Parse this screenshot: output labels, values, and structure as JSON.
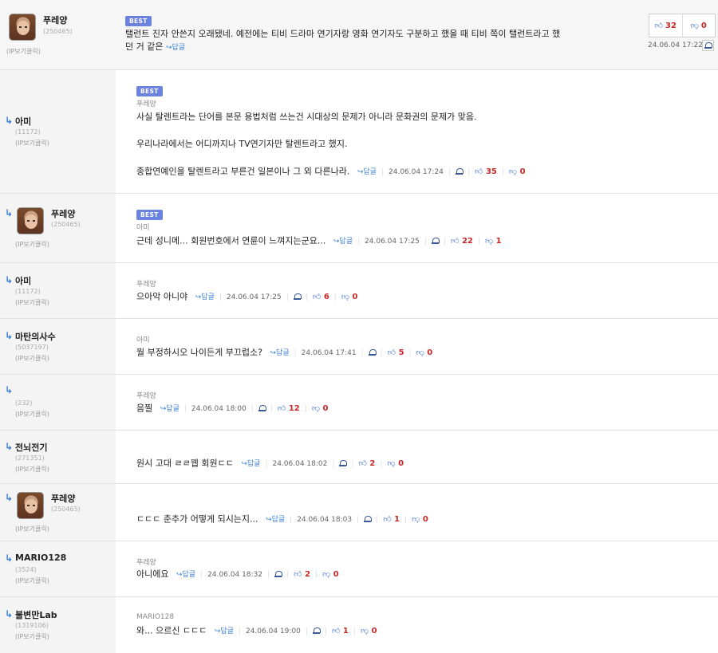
{
  "labels": {
    "best": "BEST",
    "ip": "(IP보기클릭)",
    "reply": "↪답글",
    "up_icon": "thumb-up-icon",
    "down_icon": "thumb-down-icon"
  },
  "comments": [
    {
      "nick": "푸레양",
      "num": "(250465)",
      "avatar": true,
      "best": true,
      "text_lines": [
        "탤런트 진자 안쓴지 오래됐네. 예전에는 티비 드라마 연기자랑 영화 연기자도 구분하고 했을 때 티비 쪽이 탤런트라고 했",
        "던 거 같은"
      ],
      "ts": "24.06.04 17:22",
      "up": "32",
      "down": "0"
    },
    {
      "nick": "아미",
      "num": "(11172)",
      "avatar": false,
      "best": true,
      "mention": "푸레양",
      "text_lines": [
        "사실 탈렌트라는 단어를 본문 용법처럼 쓰는건 시대상의 문제가 아니라 문화권의 문제가 맞음.",
        "",
        "우리나라에서는 어디까지나 TV연기자만 탈렌트라고 했지.",
        "",
        "종합연예인을 탈렌트라고 부른건 일본이나 그 외 다른나라."
      ],
      "ts": "24.06.04 17:24",
      "up": "35",
      "down": "0"
    },
    {
      "nick": "푸레양",
      "num": "(250465)",
      "avatar": true,
      "best": true,
      "mention": "아미",
      "text": "근데 성니메... 회원번호에서 연륜이 느껴지는군요...",
      "ts": "24.06.04 17:25",
      "up": "22",
      "down": "1"
    },
    {
      "nick": "아미",
      "num": "(11172)",
      "avatar": false,
      "mention": "푸레양",
      "text": "으아악 아니야",
      "ts": "24.06.04 17:25",
      "up": "6",
      "down": "0"
    },
    {
      "nick": "마탄의사수",
      "num": "(5037197)",
      "avatar": false,
      "mention": "아미",
      "text": "뭘 부정하시오 나이든게 부끄럽소?",
      "ts": "24.06.04 17:41",
      "up": "5",
      "down": "0"
    },
    {
      "nick": "",
      "num": "(232)",
      "avatar": false,
      "mention": "푸레양",
      "text": "음찔",
      "ts": "24.06.04 18:00",
      "up": "12",
      "down": "0"
    },
    {
      "nick": "전뇌전기",
      "num": "(271351)",
      "avatar": false,
      "text": "원시 고대 ㄹㄹ웹 회원ㄷㄷ",
      "ts": "24.06.04 18:02",
      "up": "2",
      "down": "0"
    },
    {
      "nick": "푸레양",
      "num": "(250465)",
      "avatar": true,
      "text": "ㄷㄷㄷ 춘추가 어떻게 되시는지...",
      "ts": "24.06.04 18:03",
      "up": "1",
      "down": "0"
    },
    {
      "nick": "MARIO128",
      "num": "(3524)",
      "avatar": false,
      "mention": "푸레양",
      "text": "아니에요",
      "ts": "24.06.04 18:32",
      "up": "2",
      "down": "0"
    },
    {
      "nick": "불변만Lab",
      "num": "(1319106)",
      "avatar": false,
      "mention": "MARIO128",
      "text": "와... 으르신 ㄷㄷㄷ",
      "ts": "24.06.04 19:00",
      "up": "1",
      "down": "0"
    }
  ]
}
